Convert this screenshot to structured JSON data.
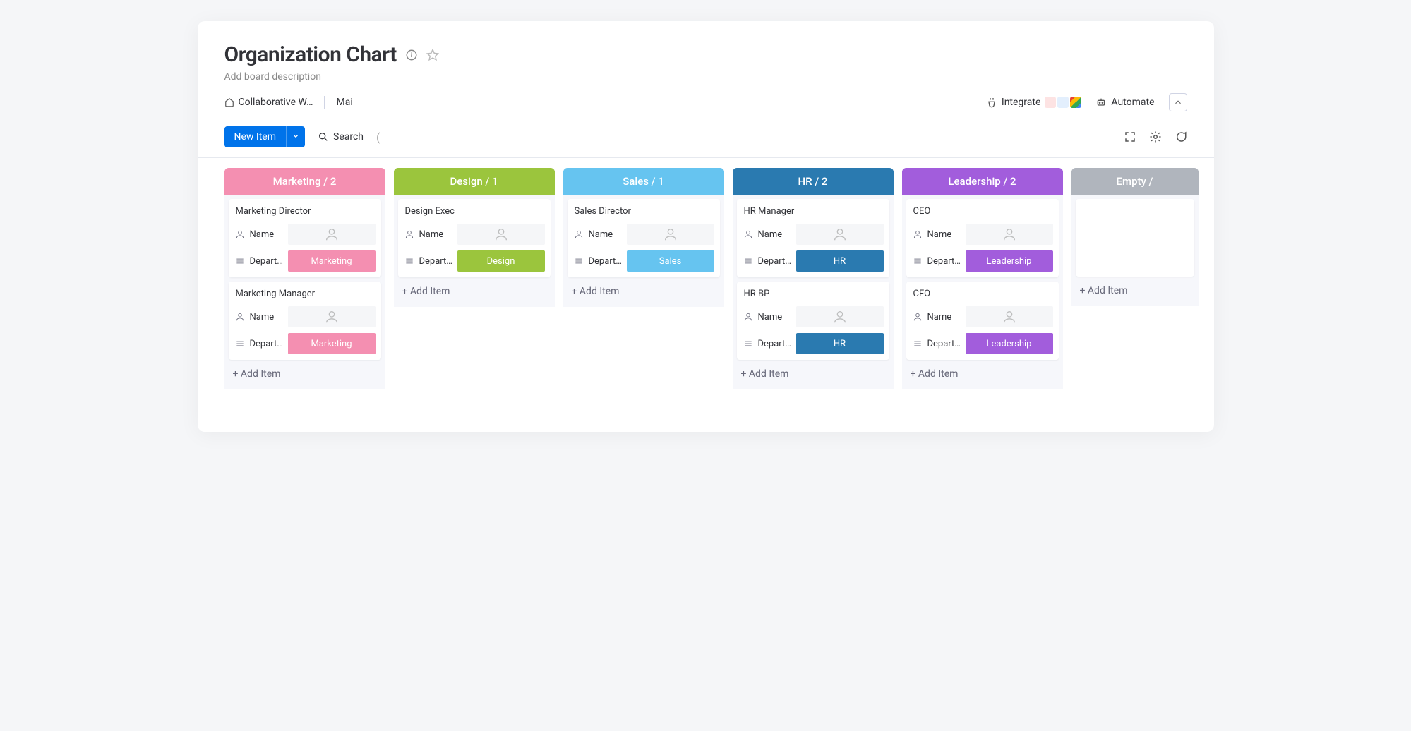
{
  "header": {
    "title": "Organization Chart",
    "description": "Add board description"
  },
  "tabs": {
    "workspace": "Collaborative W…",
    "main": "Mai",
    "integrate": "Integrate",
    "automate": "Automate"
  },
  "toolbar": {
    "new_item": "New Item",
    "search": "Search"
  },
  "labels": {
    "name": "Name",
    "department": "Depart…",
    "add_item": "+ Add Item"
  },
  "columns": [
    {
      "header": "Marketing / 2",
      "header_bg": "#f48fb1",
      "cards": [
        {
          "title": "Marketing Director",
          "dept_value": "Marketing",
          "dept_bg": "#f48fb1"
        },
        {
          "title": "Marketing Manager",
          "dept_value": "Marketing",
          "dept_bg": "#f48fb1"
        }
      ]
    },
    {
      "header": "Design / 1",
      "header_bg": "#9bc53d",
      "cards": [
        {
          "title": "Design Exec",
          "dept_value": "Design",
          "dept_bg": "#9bc53d"
        }
      ]
    },
    {
      "header": "Sales / 1",
      "header_bg": "#66c4f0",
      "cards": [
        {
          "title": "Sales Director",
          "dept_value": "Sales",
          "dept_bg": "#66c4f0"
        }
      ]
    },
    {
      "header": "HR / 2",
      "header_bg": "#2a7ab0",
      "cards": [
        {
          "title": "HR Manager",
          "dept_value": "HR",
          "dept_bg": "#2a7ab0"
        },
        {
          "title": "HR BP",
          "dept_value": "HR",
          "dept_bg": "#2a7ab0"
        }
      ]
    },
    {
      "header": "Leadership / 2",
      "header_bg": "#a25ddc",
      "cards": [
        {
          "title": "CEO",
          "dept_value": "Leadership",
          "dept_bg": "#a25ddc"
        },
        {
          "title": "CFO",
          "dept_value": "Leadership",
          "dept_bg": "#a25ddc"
        }
      ]
    },
    {
      "header": "Empty /",
      "header_bg": "#b0b5bd",
      "empty": true
    }
  ]
}
